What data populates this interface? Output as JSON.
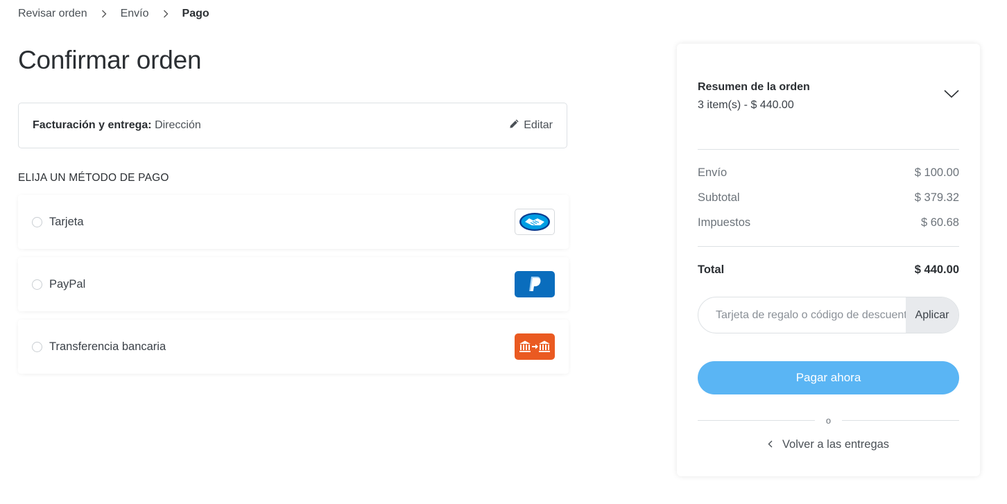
{
  "breadcrumb": {
    "items": [
      {
        "label": "Revisar orden"
      },
      {
        "label": "Envío"
      },
      {
        "label": "Pago"
      }
    ]
  },
  "page_title": "Confirmar orden",
  "billing": {
    "label": "Facturación y entrega:",
    "value": "Dirección",
    "edit_label": "Editar",
    "edit_icon": "pencil-icon"
  },
  "payment": {
    "section_title": "ELIJA UN MÉTODO DE PAGO",
    "methods": [
      {
        "label": "Tarjeta",
        "icon": "mercadopago-handshake-icon"
      },
      {
        "label": "PayPal",
        "icon": "paypal-icon"
      },
      {
        "label": "Transferencia bancaria",
        "icon": "bank-transfer-icon"
      }
    ]
  },
  "summary": {
    "title": "Resumen de la orden",
    "subtitle": "3 item(s) -  $ 440.00",
    "rows": [
      {
        "label": "Envío",
        "value": "$ 100.00"
      },
      {
        "label": "Subtotal",
        "value": "$ 379.32"
      },
      {
        "label": "Impuestos",
        "value": "$ 60.68"
      }
    ],
    "total_label": "Total",
    "total_value": "$ 440.00",
    "promo_placeholder": "Tarjeta de regalo o código de descuento",
    "apply_label": "Aplicar",
    "pay_label": "Pagar ahora",
    "or_label": "o",
    "back_label": "Volver a las entregas"
  },
  "colors": {
    "pay_button": "#5ab5f4",
    "paypal": "#0a6dbd",
    "bank_transfer": "#ea5a21",
    "mercadopago": "#009ee3"
  }
}
